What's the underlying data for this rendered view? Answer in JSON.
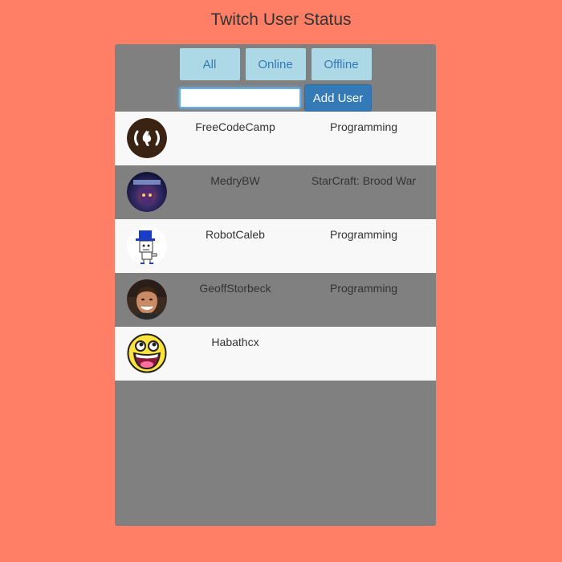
{
  "header": {
    "title": "Twitch User Status"
  },
  "filters": [
    {
      "label": "All"
    },
    {
      "label": "Online"
    },
    {
      "label": "Offline"
    }
  ],
  "add_user": {
    "input_value": "",
    "button_label": "Add User"
  },
  "users": [
    {
      "name": "FreeCodeCamp",
      "game": "Programming",
      "avatar": "freecodecamp-logo-icon"
    },
    {
      "name": "MedryBW",
      "game": "StarCraft: Brood War",
      "avatar": "starcraft-avatar-icon"
    },
    {
      "name": "RobotCaleb",
      "game": "Programming",
      "avatar": "robot-avatar-icon"
    },
    {
      "name": "GeoffStorbeck",
      "game": "Programming",
      "avatar": "person-photo-avatar"
    },
    {
      "name": "Habathcx",
      "game": "",
      "avatar": "smiley-face-avatar-icon"
    }
  ],
  "colors": {
    "background": "#ff7f66",
    "panel": "#808080",
    "row_light": "#f8f8f8",
    "filter_button": "#add8e6",
    "primary_button": "#337ab7"
  }
}
